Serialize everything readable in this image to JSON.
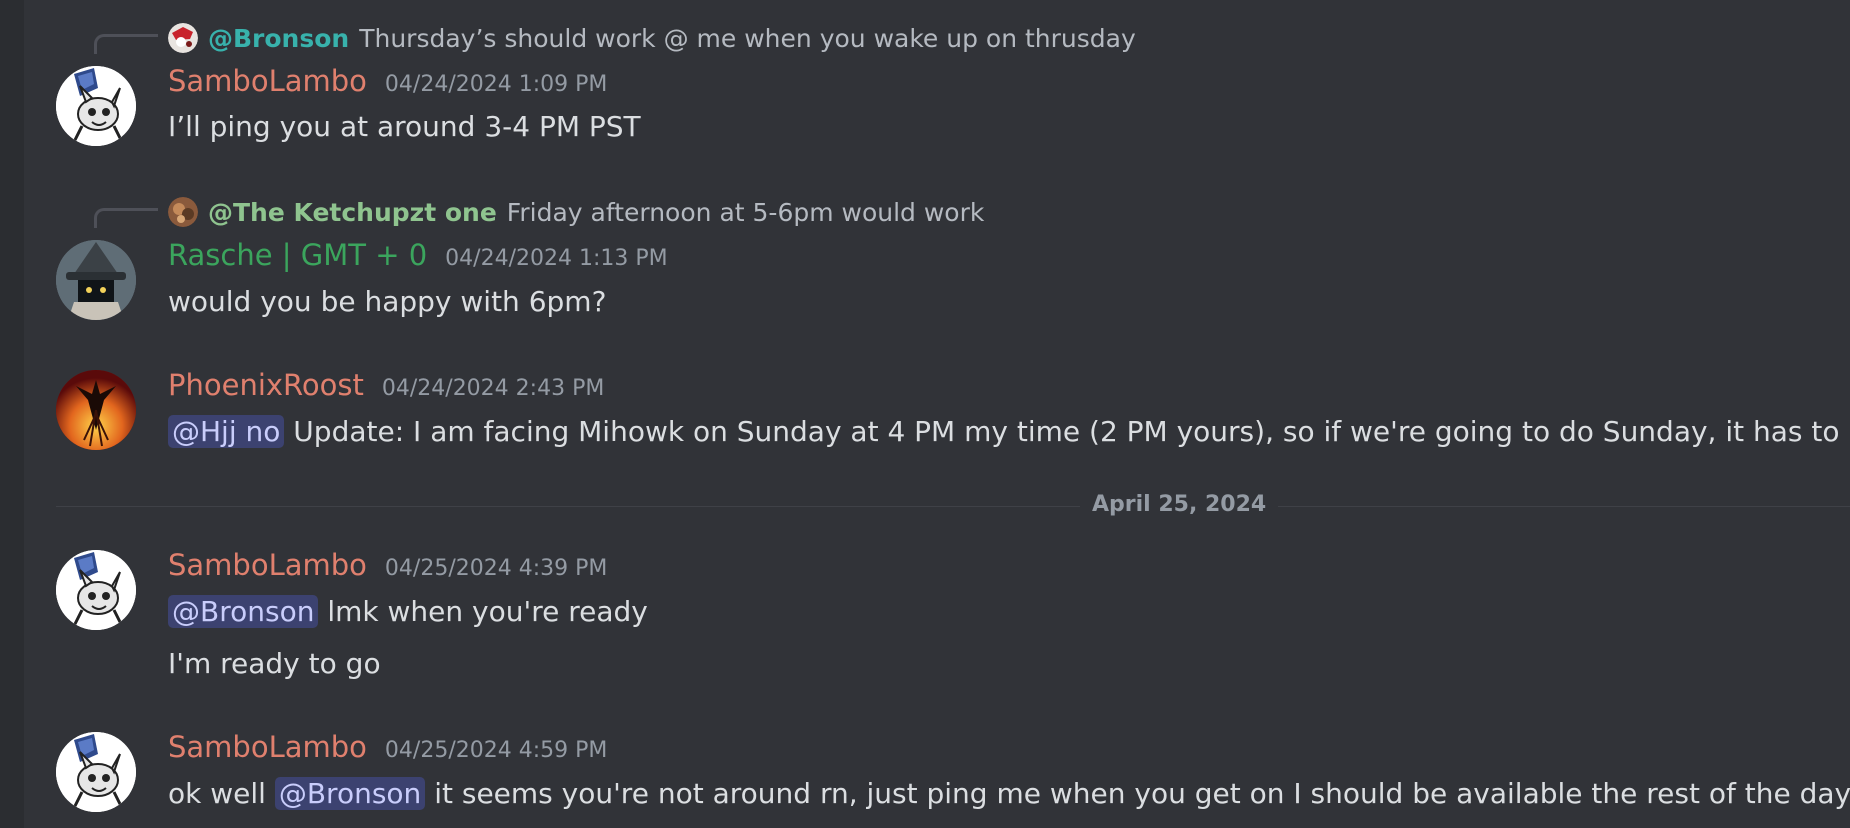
{
  "colors": {
    "background": "#313338",
    "sambolambo": "#e0806e",
    "rasche": "#3ba55d",
    "phoenix": "#e0806e",
    "reply_bronson": "#38b2ac",
    "reply_ketchup": "#8fc48f",
    "mention_bg": "#3c4270"
  },
  "messages": [
    {
      "reply": {
        "avatar_icon": "bronson-avatar-icon",
        "mention": "@Bronson",
        "text": "Thursday’s should work @ me when you wake up on thrusday"
      },
      "author": "SamboLambo",
      "timestamp": "04/24/2024 1:09 PM",
      "avatar_icon": "sambolambo-avatar-icon",
      "lines": [
        "I’ll ping you at around 3-4 PM PST"
      ]
    },
    {
      "reply": {
        "avatar_icon": "ketchupzt-avatar-icon",
        "mention": "@The Ketchupzt one",
        "text": "Friday afternoon at 5-6pm would work"
      },
      "author": "Rasche | GMT + 0",
      "timestamp": "04/24/2024 1:13 PM",
      "avatar_icon": "rasche-avatar-icon",
      "lines": [
        "would you be happy with 6pm?"
      ]
    },
    {
      "author": "PhoenixRoost",
      "timestamp": "04/24/2024 2:43 PM",
      "avatar_icon": "phoenix-avatar-icon",
      "mention": "@Hjj no",
      "text": "Update: I am facing Mihowk on Sunday at 4 PM my time (2 PM yours), so if we're going to do Sunday, it has to be a di"
    },
    {
      "author": "SamboLambo",
      "timestamp": "04/25/2024 4:39 PM",
      "avatar_icon": "sambolambo-avatar-icon",
      "mention": "@Bronson",
      "text": "lmk when you're ready",
      "followup": "I'm ready to go"
    },
    {
      "author": "SamboLambo",
      "timestamp": "04/25/2024 4:59 PM",
      "avatar_icon": "sambolambo-avatar-icon",
      "prefix": "ok well",
      "mention": "@Bronson",
      "text": "it seems you're not around rn, just ping me when you get on I should be available the rest of the day"
    }
  ],
  "date_divider": "April 25, 2024"
}
